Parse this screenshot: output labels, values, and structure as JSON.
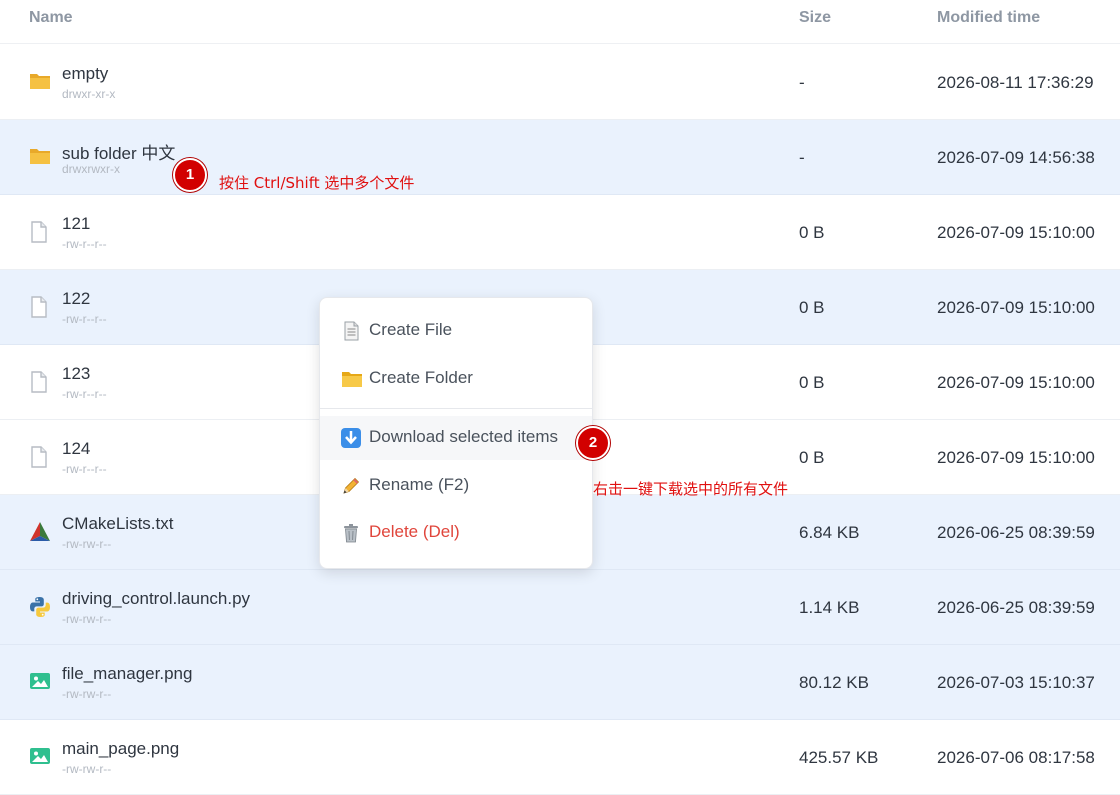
{
  "header": {
    "name": "Name",
    "size": "Size",
    "modified": "Modified time"
  },
  "files": [
    {
      "name": "empty",
      "perm": "drwxr-xr-x",
      "size": "-",
      "time": "2026-08-11 17:36:29",
      "icon": "folder-icon",
      "selected": false
    },
    {
      "name": "sub folder 中文",
      "perm": "drwxrwxr-x",
      "size": "-",
      "time": "2026-07-09 14:56:38",
      "icon": "folder-icon",
      "selected": true
    },
    {
      "name": "121",
      "perm": "-rw-r--r--",
      "size": "0 B",
      "time": "2026-07-09 15:10:00",
      "icon": "file-icon",
      "selected": false
    },
    {
      "name": "122",
      "perm": "-rw-r--r--",
      "size": "0 B",
      "time": "2026-07-09 15:10:00",
      "icon": "file-icon",
      "selected": true
    },
    {
      "name": "123",
      "perm": "-rw-r--r--",
      "size": "0 B",
      "time": "2026-07-09 15:10:00",
      "icon": "file-icon",
      "selected": false
    },
    {
      "name": "124",
      "perm": "-rw-r--r--",
      "size": "0 B",
      "time": "2026-07-09 15:10:00",
      "icon": "file-icon",
      "selected": false
    },
    {
      "name": "CMakeLists.txt",
      "perm": "-rw-rw-r--",
      "size": "6.84 KB",
      "time": "2026-06-25 08:39:59",
      "icon": "cmake-icon",
      "selected": true
    },
    {
      "name": "driving_control.launch.py",
      "perm": "-rw-rw-r--",
      "size": "1.14 KB",
      "time": "2026-06-25 08:39:59",
      "icon": "python-icon",
      "selected": true
    },
    {
      "name": "file_manager.png",
      "perm": "-rw-rw-r--",
      "size": "80.12 KB",
      "time": "2026-07-03 15:10:37",
      "icon": "image-icon",
      "selected": true
    },
    {
      "name": "main_page.png",
      "perm": "-rw-rw-r--",
      "size": "425.57 KB",
      "time": "2026-07-06 08:17:58",
      "icon": "image-icon",
      "selected": false
    }
  ],
  "menu": {
    "create_file": "Create File",
    "create_folder": "Create Folder",
    "download": "Download selected items",
    "rename": "Rename (F2)",
    "delete": "Delete (Del)"
  },
  "annotations": {
    "badge1": "1",
    "text1": "按住 Ctrl/Shift 选中多个文件",
    "badge2": "2",
    "text2": "右击一键下载选中的所有文件"
  },
  "colors": {
    "selected_row": "#eaf2fd",
    "folder": "#f5c142",
    "danger": "#e0453b",
    "annotation": "#e01010"
  }
}
